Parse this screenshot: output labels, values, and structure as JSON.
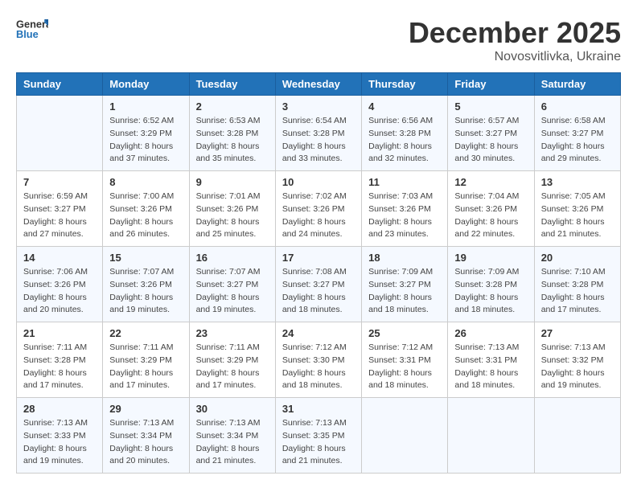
{
  "header": {
    "logo_general": "General",
    "logo_blue": "Blue",
    "month_title": "December 2025",
    "subtitle": "Novosvitlivka, Ukraine"
  },
  "weekdays": [
    "Sunday",
    "Monday",
    "Tuesday",
    "Wednesday",
    "Thursday",
    "Friday",
    "Saturday"
  ],
  "weeks": [
    [
      {
        "day": "",
        "info": ""
      },
      {
        "day": "1",
        "info": "Sunrise: 6:52 AM\nSunset: 3:29 PM\nDaylight: 8 hours\nand 37 minutes."
      },
      {
        "day": "2",
        "info": "Sunrise: 6:53 AM\nSunset: 3:28 PM\nDaylight: 8 hours\nand 35 minutes."
      },
      {
        "day": "3",
        "info": "Sunrise: 6:54 AM\nSunset: 3:28 PM\nDaylight: 8 hours\nand 33 minutes."
      },
      {
        "day": "4",
        "info": "Sunrise: 6:56 AM\nSunset: 3:28 PM\nDaylight: 8 hours\nand 32 minutes."
      },
      {
        "day": "5",
        "info": "Sunrise: 6:57 AM\nSunset: 3:27 PM\nDaylight: 8 hours\nand 30 minutes."
      },
      {
        "day": "6",
        "info": "Sunrise: 6:58 AM\nSunset: 3:27 PM\nDaylight: 8 hours\nand 29 minutes."
      }
    ],
    [
      {
        "day": "7",
        "info": "Sunrise: 6:59 AM\nSunset: 3:27 PM\nDaylight: 8 hours\nand 27 minutes."
      },
      {
        "day": "8",
        "info": "Sunrise: 7:00 AM\nSunset: 3:26 PM\nDaylight: 8 hours\nand 26 minutes."
      },
      {
        "day": "9",
        "info": "Sunrise: 7:01 AM\nSunset: 3:26 PM\nDaylight: 8 hours\nand 25 minutes."
      },
      {
        "day": "10",
        "info": "Sunrise: 7:02 AM\nSunset: 3:26 PM\nDaylight: 8 hours\nand 24 minutes."
      },
      {
        "day": "11",
        "info": "Sunrise: 7:03 AM\nSunset: 3:26 PM\nDaylight: 8 hours\nand 23 minutes."
      },
      {
        "day": "12",
        "info": "Sunrise: 7:04 AM\nSunset: 3:26 PM\nDaylight: 8 hours\nand 22 minutes."
      },
      {
        "day": "13",
        "info": "Sunrise: 7:05 AM\nSunset: 3:26 PM\nDaylight: 8 hours\nand 21 minutes."
      }
    ],
    [
      {
        "day": "14",
        "info": "Sunrise: 7:06 AM\nSunset: 3:26 PM\nDaylight: 8 hours\nand 20 minutes."
      },
      {
        "day": "15",
        "info": "Sunrise: 7:07 AM\nSunset: 3:26 PM\nDaylight: 8 hours\nand 19 minutes."
      },
      {
        "day": "16",
        "info": "Sunrise: 7:07 AM\nSunset: 3:27 PM\nDaylight: 8 hours\nand 19 minutes."
      },
      {
        "day": "17",
        "info": "Sunrise: 7:08 AM\nSunset: 3:27 PM\nDaylight: 8 hours\nand 18 minutes."
      },
      {
        "day": "18",
        "info": "Sunrise: 7:09 AM\nSunset: 3:27 PM\nDaylight: 8 hours\nand 18 minutes."
      },
      {
        "day": "19",
        "info": "Sunrise: 7:09 AM\nSunset: 3:28 PM\nDaylight: 8 hours\nand 18 minutes."
      },
      {
        "day": "20",
        "info": "Sunrise: 7:10 AM\nSunset: 3:28 PM\nDaylight: 8 hours\nand 17 minutes."
      }
    ],
    [
      {
        "day": "21",
        "info": "Sunrise: 7:11 AM\nSunset: 3:28 PM\nDaylight: 8 hours\nand 17 minutes."
      },
      {
        "day": "22",
        "info": "Sunrise: 7:11 AM\nSunset: 3:29 PM\nDaylight: 8 hours\nand 17 minutes."
      },
      {
        "day": "23",
        "info": "Sunrise: 7:11 AM\nSunset: 3:29 PM\nDaylight: 8 hours\nand 17 minutes."
      },
      {
        "day": "24",
        "info": "Sunrise: 7:12 AM\nSunset: 3:30 PM\nDaylight: 8 hours\nand 18 minutes."
      },
      {
        "day": "25",
        "info": "Sunrise: 7:12 AM\nSunset: 3:31 PM\nDaylight: 8 hours\nand 18 minutes."
      },
      {
        "day": "26",
        "info": "Sunrise: 7:13 AM\nSunset: 3:31 PM\nDaylight: 8 hours\nand 18 minutes."
      },
      {
        "day": "27",
        "info": "Sunrise: 7:13 AM\nSunset: 3:32 PM\nDaylight: 8 hours\nand 19 minutes."
      }
    ],
    [
      {
        "day": "28",
        "info": "Sunrise: 7:13 AM\nSunset: 3:33 PM\nDaylight: 8 hours\nand 19 minutes."
      },
      {
        "day": "29",
        "info": "Sunrise: 7:13 AM\nSunset: 3:34 PM\nDaylight: 8 hours\nand 20 minutes."
      },
      {
        "day": "30",
        "info": "Sunrise: 7:13 AM\nSunset: 3:34 PM\nDaylight: 8 hours\nand 21 minutes."
      },
      {
        "day": "31",
        "info": "Sunrise: 7:13 AM\nSunset: 3:35 PM\nDaylight: 8 hours\nand 21 minutes."
      },
      {
        "day": "",
        "info": ""
      },
      {
        "day": "",
        "info": ""
      },
      {
        "day": "",
        "info": ""
      }
    ]
  ]
}
